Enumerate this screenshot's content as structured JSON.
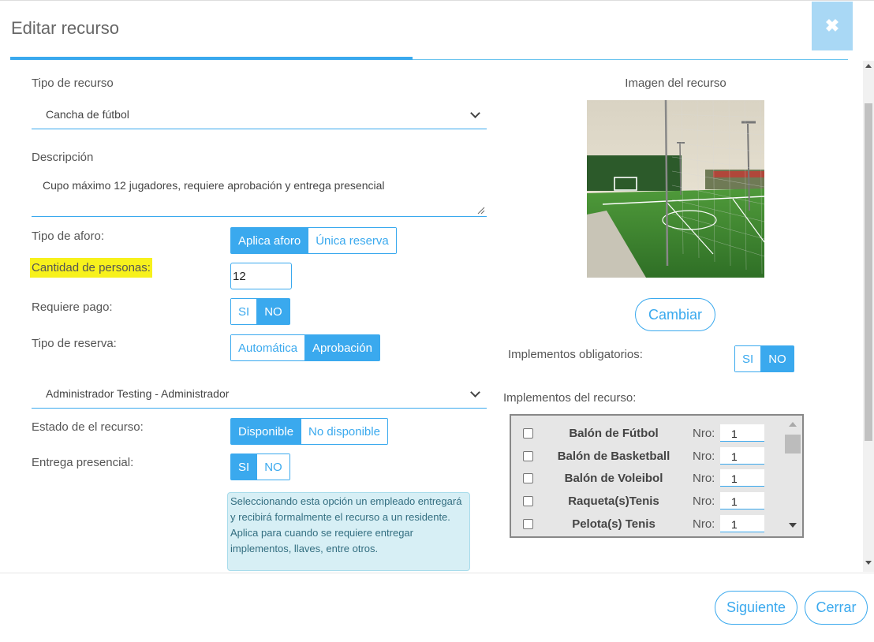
{
  "modal": {
    "title": "Editar recurso",
    "close_icon": "close-x-icon",
    "progress_percent": 47
  },
  "form": {
    "tipo_recurso": {
      "label": "Tipo de recurso",
      "value": "Cancha de fútbol"
    },
    "descripcion": {
      "label": "Descripción",
      "value": "Cupo máximo 12 jugadores, requiere aprobación y entrega presencial"
    },
    "tipo_aforo": {
      "label": "Tipo de aforo:",
      "options": [
        "Aplica aforo",
        "Única reserva"
      ],
      "selected": "Aplica aforo"
    },
    "cantidad_personas": {
      "label": "Cantidad de personas:",
      "value": "12"
    },
    "requiere_pago": {
      "label": "Requiere pago:",
      "options": [
        "SI",
        "NO"
      ],
      "selected": "NO"
    },
    "tipo_reserva": {
      "label": "Tipo de reserva:",
      "options": [
        "Automática",
        "Aprobación"
      ],
      "selected": "Aprobación"
    },
    "administrador": {
      "value": "Administrador Testing - Administrador"
    },
    "estado": {
      "label": "Estado de el recurso:",
      "options": [
        "Disponible",
        "No disponible"
      ],
      "selected": "Disponible"
    },
    "entrega_presencial": {
      "label": "Entrega presencial:",
      "options": [
        "SI",
        "NO"
      ],
      "selected": "SI",
      "info": "Seleccionando esta opción un empleado entregará y recibirá formalmente el recurso a un residente. Aplica para cuando se requiere entregar implementos, llaves, entre otros."
    }
  },
  "image_panel": {
    "title": "Imagen del recurso",
    "image_alt": "soccer-field-photo",
    "change_button": "Cambiar"
  },
  "implementos_obligatorios": {
    "label": "Implementos obligatorios:",
    "options": [
      "SI",
      "NO"
    ],
    "selected": "NO"
  },
  "implementos": {
    "label": "Implementos del recurso:",
    "nro_label": "Nro:",
    "items": [
      {
        "name": "Balón de Fútbol",
        "qty": "1",
        "checked": false
      },
      {
        "name": "Balón de Basketball",
        "qty": "1",
        "checked": false
      },
      {
        "name": "Balón de Voleibol",
        "qty": "1",
        "checked": false
      },
      {
        "name": "Raqueta(s)Tenis",
        "qty": "1",
        "checked": false
      },
      {
        "name": "Pelota(s) Tenis",
        "qty": "1",
        "checked": false
      }
    ]
  },
  "footer": {
    "next_button": "Siguiente",
    "close_button": "Cerrar"
  },
  "colors": {
    "accent": "#3aa9ee",
    "highlight": "#f7f11c",
    "info_bg": "#d7eff5"
  }
}
